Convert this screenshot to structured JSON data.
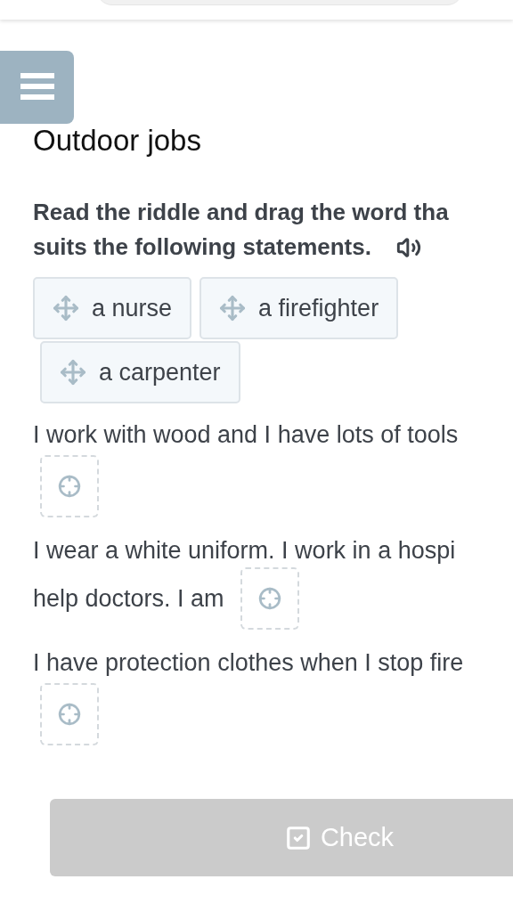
{
  "title": "Outdoor jobs",
  "instruction": [
    "Read the riddle and drag the word tha",
    "suits the following statements."
  ],
  "words": [
    {
      "label": "a nurse"
    },
    {
      "label": "a firefighter"
    },
    {
      "label": "a carpenter"
    }
  ],
  "statements": [
    {
      "lines": [
        "I work with wood and I have lots of tools"
      ]
    },
    {
      "lines": [
        "I wear a white uniform. I work in a hospi",
        "help doctors. I am"
      ]
    },
    {
      "lines": [
        "I have protection clothes when I stop fire"
      ]
    }
  ],
  "check_button": {
    "label": "Check",
    "disabled": true
  }
}
